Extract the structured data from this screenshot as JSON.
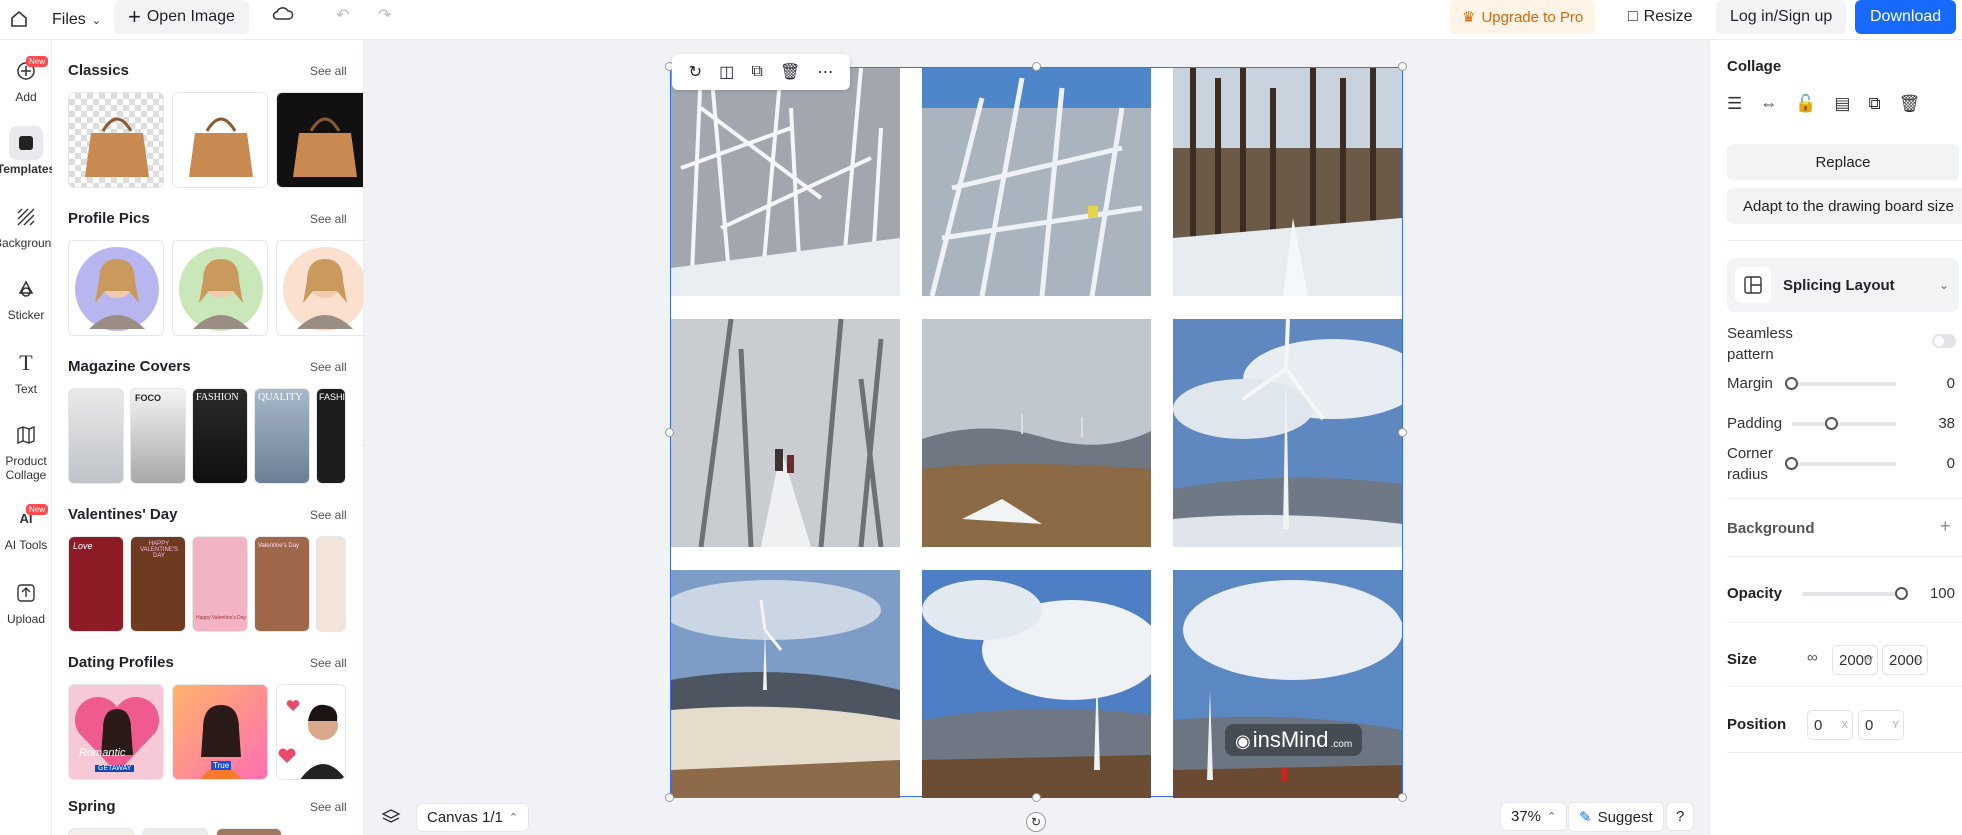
{
  "topbar": {
    "files_label": "Files",
    "open_image_label": "Open Image",
    "upgrade_label": "Upgrade to Pro",
    "resize_label": "Resize",
    "login_label": "Log in/Sign up",
    "download_label": "Download",
    "accent": "#1769ff"
  },
  "rail": {
    "items": [
      {
        "label": "Add",
        "icon": "plus-circle-icon",
        "badge": "New"
      },
      {
        "label": "Templates",
        "icon": "template-icon"
      },
      {
        "label": "Background",
        "icon": "hatch-icon"
      },
      {
        "label": "Sticker",
        "icon": "sticker-icon"
      },
      {
        "label": "Text",
        "icon": "text-icon"
      },
      {
        "label": "Product Collage",
        "icon": "map-icon"
      },
      {
        "label": "AI Tools",
        "icon": "ai-icon",
        "badge": "New"
      },
      {
        "label": "Upload",
        "icon": "upload-icon"
      }
    ]
  },
  "panel": {
    "see_all": "See all",
    "sections": [
      {
        "title": "Classics"
      },
      {
        "title": "Profile Pics"
      },
      {
        "title": "Magazine Covers"
      },
      {
        "title": "Valentines' Day"
      },
      {
        "title": "Dating Profiles"
      },
      {
        "title": "Spring"
      }
    ],
    "magazine_texts": [
      "FOCO",
      "FASHION",
      "QUALITY",
      "FASHI"
    ],
    "valentine_texts": [
      "Love",
      "HAPPY VALENTINE'S DAY",
      "Happy Valentine's Day",
      "Valentine's Day"
    ],
    "dating_texts": [
      "Romantic",
      "GETAWAY",
      "True"
    ]
  },
  "canvas": {
    "toolbar_icons": [
      "refresh-icon",
      "layout-icon",
      "duplicate-icon",
      "trash-icon",
      "more-icon"
    ],
    "watermark": "insMind",
    "watermark_suffix": ".com"
  },
  "bottombar": {
    "canvas_label": "Canvas 1/1",
    "zoom_label": "37%",
    "suggest_label": "Suggest",
    "help_label": "?"
  },
  "right": {
    "title": "Collage",
    "replace_label": "Replace",
    "adapt_label": "Adapt to the drawing board size",
    "layout_label": "Splicing Layout",
    "seamless_label": "Seamless pattern",
    "margin_label": "Margin",
    "margin_value": "0",
    "margin_fraction": 0,
    "padding_label": "Padding",
    "padding_value": "38",
    "padding_fraction": 0.38,
    "corner_label": "Corner radius",
    "corner_value": "0",
    "corner_fraction": 0,
    "background_label": "Background",
    "opacity_label": "Opacity",
    "opacity_value": "100",
    "opacity_fraction": 1,
    "size_label": "Size",
    "size_w": "2000",
    "size_h": "2000",
    "size_w_unit": "W",
    "size_h_unit": "H",
    "position_label": "Position",
    "pos_x": "0",
    "pos_y": "0",
    "pos_x_unit": "X",
    "pos_y_unit": "Y"
  }
}
